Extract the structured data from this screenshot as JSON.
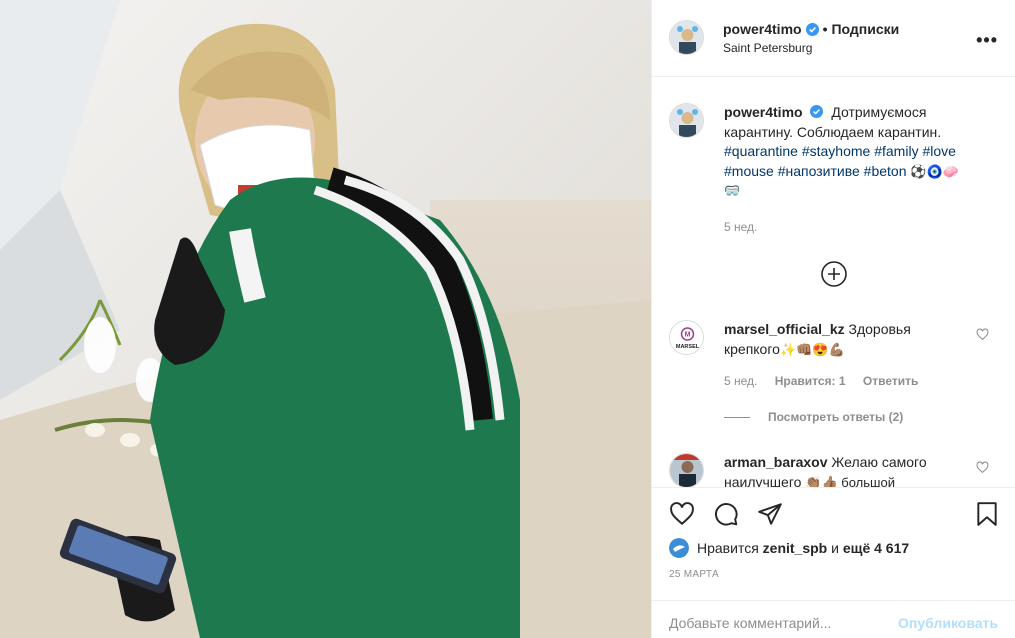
{
  "post": {
    "username": "power4timo",
    "follow_label": "Подписки",
    "separator": "•",
    "location": "Saint Petersburg",
    "more": "•••"
  },
  "caption": {
    "username": "power4timo",
    "text": "Дотримуємося карантину. Соблюдаем карантин.",
    "hashtags": [
      "#quarantine",
      "#stayhome",
      "#family",
      "#love",
      "#mouse",
      "#напозитиве",
      "#beton"
    ],
    "emojis": "⚽🧿🧼🥽",
    "age": "5 нед."
  },
  "comments": [
    {
      "username": "marsel_official_kz",
      "text": "Здоровья крепкого",
      "emojis": "✨👊🏽😍💪🏽",
      "age": "5 нед.",
      "likes": "Нравится: 1",
      "reply": "Ответить",
      "avatar_label": "MARSEL"
    },
    {
      "username": "arman_baraxov",
      "text": "Желаю самого наилучшего",
      "emojis": "👏🏽👍🏽 большой"
    }
  ],
  "view_replies": "Посмотреть ответы (2)",
  "likes_line": {
    "prefix": "Нравится",
    "user": "zenit_spb",
    "middle": "и",
    "more": "ещё 4 617"
  },
  "date": "25 МАРТА",
  "add_comment": {
    "placeholder": "Добавьте комментарий...",
    "publish": "Опубликовать"
  },
  "colors": {
    "link": "#00376b",
    "verified": "#3897f0",
    "muted": "#8e8e8e",
    "publish_disabled": "#b2dffc"
  }
}
